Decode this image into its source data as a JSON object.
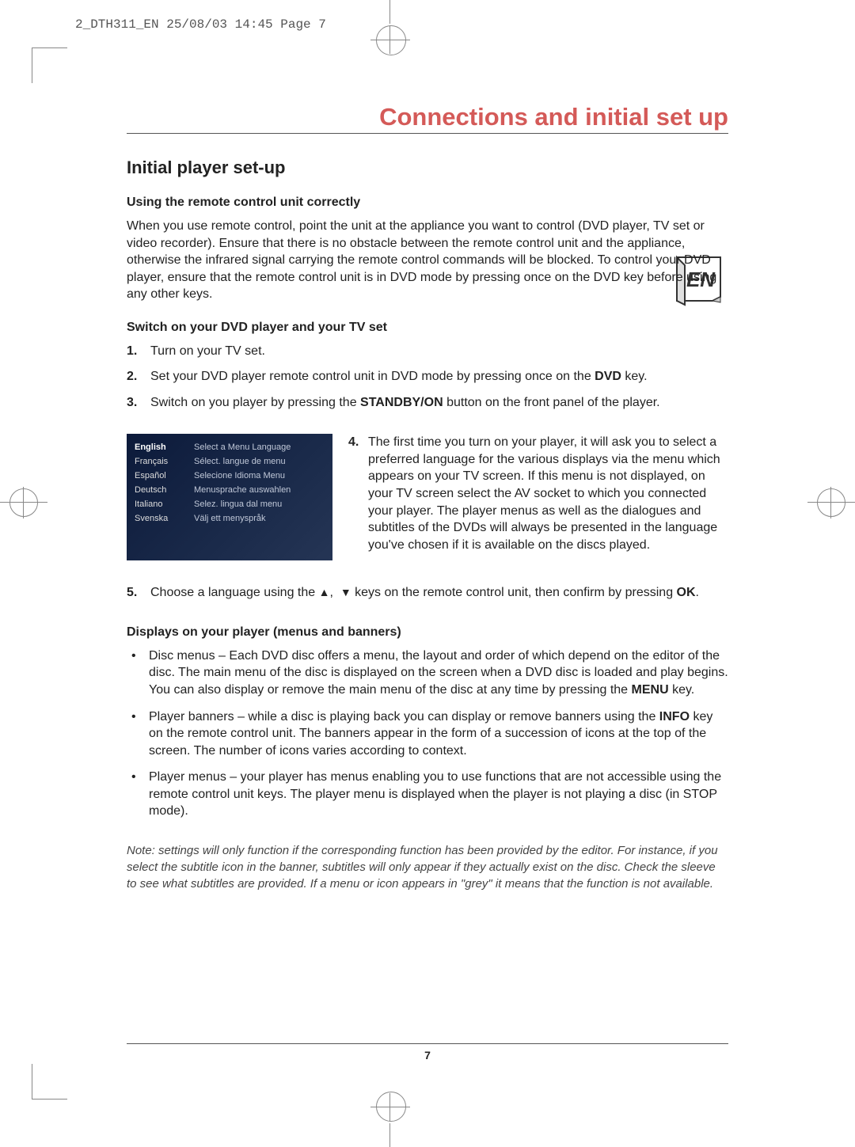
{
  "print_header": "2_DTH311_EN  25/08/03  14:45  Page 7",
  "section_title": "Connections and initial set up",
  "h2": "Initial player set-up",
  "sub1": {
    "title": "Using the remote control unit correctly",
    "body": "When you use remote control, point the unit at the appliance you want to control (DVD player, TV set or video recorder). Ensure that there is no obstacle between the remote control unit and the appliance, otherwise the infrared signal carrying the remote control commands will be blocked. To control your DVD player, ensure that the remote control unit is in DVD mode by pressing once on the DVD key before using any other keys."
  },
  "sub2": {
    "title": "Switch on your DVD player and your TV set",
    "steps": [
      {
        "n": "1.",
        "t": "Turn on your TV set."
      },
      {
        "n": "2.",
        "pre": "Set your DVD player remote control unit in DVD mode by pressing once on the ",
        "bold": "DVD",
        "post": " key."
      },
      {
        "n": "3.",
        "pre": "Switch on you player by pressing the ",
        "bold": "STANDBY/ON",
        "post": " button on the front panel of the player."
      }
    ],
    "step4": {
      "n": "4.",
      "t": "The first time you turn on your player, it will ask you to select a preferred language for the various displays via the menu which appears on your TV screen. If this menu is not displayed, on your TV screen select the AV socket to which you connected your player. The player menus as well as the dialogues and subtitles of the DVDs will always be presented in the language you've chosen if it is available on the discs played."
    },
    "step5": {
      "n": "5.",
      "pre": "Choose a language using the ",
      "mid": " keys on the remote control unit, then confirm by pressing ",
      "bold": "OK",
      "post": "."
    }
  },
  "menu": {
    "rows": [
      {
        "lang": "English",
        "prompt": "Select a Menu Language"
      },
      {
        "lang": "Français",
        "prompt": "Sélect. langue de menu"
      },
      {
        "lang": "Español",
        "prompt": "Selecione Idioma Menu"
      },
      {
        "lang": "Deutsch",
        "prompt": "Menusprache auswahlen"
      },
      {
        "lang": "Italiano",
        "prompt": "Selez. lingua dal menu"
      },
      {
        "lang": "Svenska",
        "prompt": "Välj ett menyspråk"
      }
    ]
  },
  "sub3": {
    "title": "Displays on your player (menus and banners)",
    "bullets": [
      {
        "pre": "Disc menus – Each DVD disc offers a menu, the layout and order of which depend on the editor of the disc. The main menu of the disc is displayed on the screen when a DVD disc is loaded and play begins. You can also display or remove the main menu of the disc at any time by pressing the ",
        "bold": "MENU",
        "post": " key."
      },
      {
        "pre": "Player banners – while a disc is playing back you can display or remove banners using the ",
        "bold": "INFO",
        "post": " key on the remote control unit. The banners appear in the form of a succession of icons at the top of the screen. The number of icons varies according to context."
      },
      {
        "pre": "Player menus – your player has menus enabling you to use functions that are not accessible using the remote control unit keys. The player menu is displayed when the player is not playing a disc (in STOP mode).",
        "bold": "",
        "post": ""
      }
    ]
  },
  "note": "Note: settings will only function if the corresponding function has been provided by the editor. For instance, if you select the subtitle icon in the banner, subtitles will only appear if they actually exist on the disc. Check the sleeve to see what subtitles are provided. If a menu or icon appears in \"grey\" it means that the function is not available.",
  "page_number": "7",
  "lang_badge": "EN"
}
